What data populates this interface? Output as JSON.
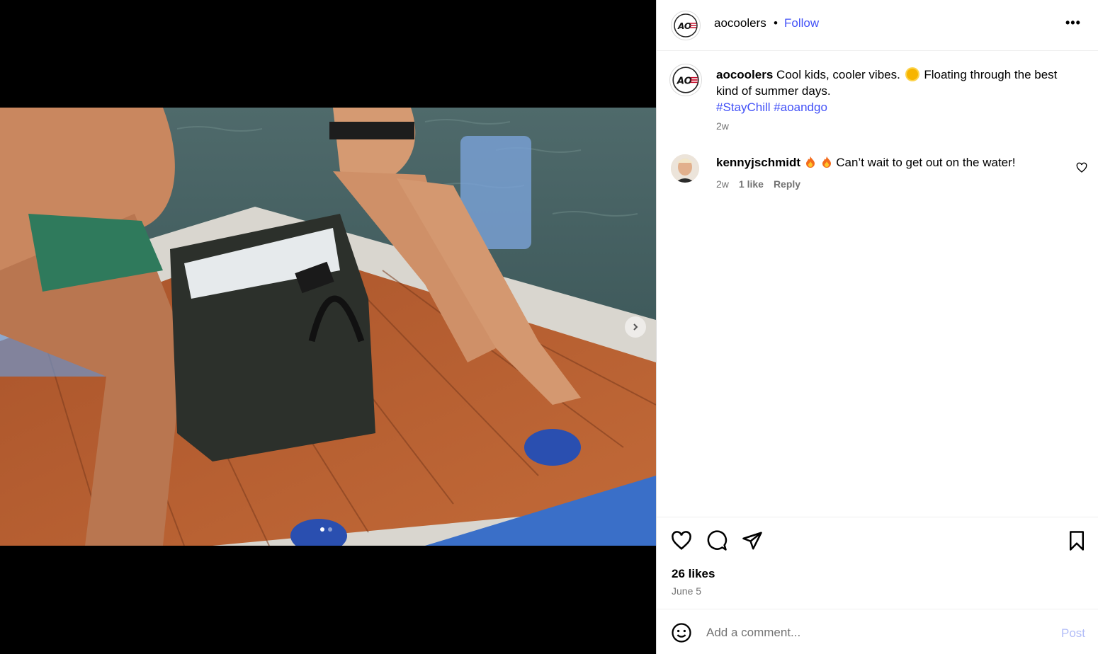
{
  "post": {
    "username": "aocoolers",
    "separator": "•",
    "follow_label": "Follow",
    "more_label": "•••",
    "caption": {
      "username": "aocoolers",
      "text_1": "Cool kids, cooler vibes.",
      "emoji": "sun-emoji",
      "text_2": "Floating through the best kind of summer days.",
      "hashtags": [
        "#StayChill",
        "#aoandgo"
      ],
      "time": "2w"
    },
    "comments": [
      {
        "username": "kennyjschmidt",
        "emojis": [
          "fire-emoji",
          "fire-emoji"
        ],
        "text": "Can’t wait to get out on the water!",
        "time": "2w",
        "likes": "1 like",
        "reply_label": "Reply"
      }
    ],
    "likes": "26 likes",
    "date": "June 5"
  },
  "carousel": {
    "current": 1,
    "total": 2
  },
  "add_comment": {
    "placeholder": "Add a comment...",
    "post_label": "Post"
  },
  "icons": [
    "heart-icon",
    "comment-icon",
    "share-icon",
    "bookmark-icon",
    "emoji-icon",
    "chevron-right-icon",
    "more-icon"
  ],
  "colors": {
    "link": "#4150f7",
    "muted": "#737373",
    "post_disabled": "#b2bdf8"
  }
}
